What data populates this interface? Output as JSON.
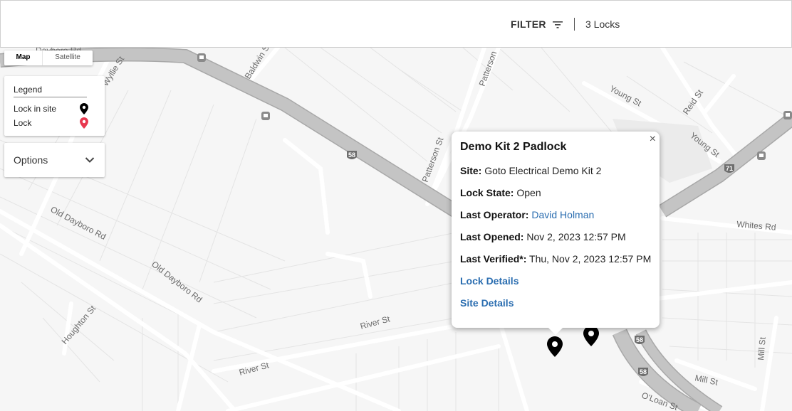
{
  "topbar": {
    "filter_label": "FILTER",
    "lock_count": "3 Locks"
  },
  "map": {
    "type_control": {
      "map_label": "Map",
      "satellite_label": "Satellite",
      "selected": "Map"
    },
    "legend": {
      "title": "Legend",
      "items": [
        {
          "label": "Lock in site",
          "icon": "pin-black-icon",
          "color": "#000000"
        },
        {
          "label": "Lock",
          "icon": "pin-red-icon",
          "color": "#e8384f"
        }
      ]
    },
    "options_label": "Options",
    "road_labels": {
      "dayboro_top": "Dayboro Rd",
      "baldwin": "Baldwin St",
      "wyllie": "Wyllie St",
      "patterson_a": "Patterson",
      "patterson_b": "Patterson St",
      "young_1": "Young St",
      "young_2": "Young St",
      "reid": "Reid St",
      "old_dayboro_1": "Old Dayboro Rd",
      "old_dayboro_2": "Old Dayboro Rd",
      "houghton": "Houghton St",
      "river_1": "River St",
      "river_2": "River St",
      "whites": "Whites Rd",
      "mill_1": "Mill St",
      "mill_2": "Mill St",
      "oloan": "O'Loan St"
    },
    "route_shields": [
      "58",
      "58",
      "58",
      "71"
    ]
  },
  "popup": {
    "title": "Demo Kit 2 Padlock",
    "site_label": "Site:",
    "site_value": "Goto Electrical Demo Kit 2",
    "state_label": "Lock State:",
    "state_value": "Open",
    "operator_label": "Last Operator:",
    "operator_value": "David Holman",
    "opened_label": "Last Opened:",
    "opened_value": "Nov 2, 2023 12:57 PM",
    "verified_label": "Last Verified*:",
    "verified_value": "Thu, Nov 2, 2023 12:57 PM",
    "lock_details_link": "Lock Details",
    "site_details_link": "Site Details",
    "close_glyph": "×"
  }
}
